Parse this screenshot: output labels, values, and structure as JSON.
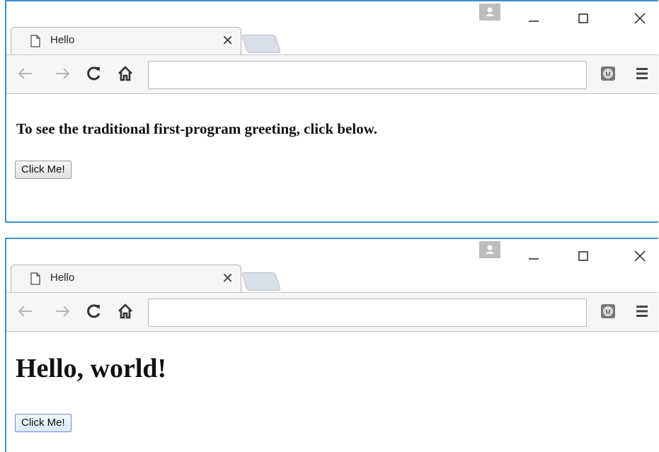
{
  "windows": [
    {
      "tab": {
        "title": "Hello"
      },
      "content": {
        "text": "To see the traditional first-program greeting, click below."
      },
      "button": {
        "label": "Click Me!"
      }
    },
    {
      "tab": {
        "title": "Hello"
      },
      "content": {
        "text": "Hello, world!"
      },
      "button": {
        "label": "Click Me!"
      }
    }
  ],
  "omnibox": {
    "value": ""
  },
  "icons": {
    "tab": [
      "document-icon",
      "close-icon"
    ],
    "titlebar": [
      "profile-icon",
      "minimize-icon",
      "maximize-icon",
      "close-window-icon"
    ],
    "toolbar": [
      "back-arrow-icon",
      "forward-arrow-icon",
      "reload-icon",
      "home-icon",
      "extension-icon",
      "menu-icon"
    ]
  },
  "colors": {
    "window_border": "#3f8fc7",
    "toolbar_bg": "#f6f6f6",
    "newtab_bg": "#d9dfe8"
  }
}
